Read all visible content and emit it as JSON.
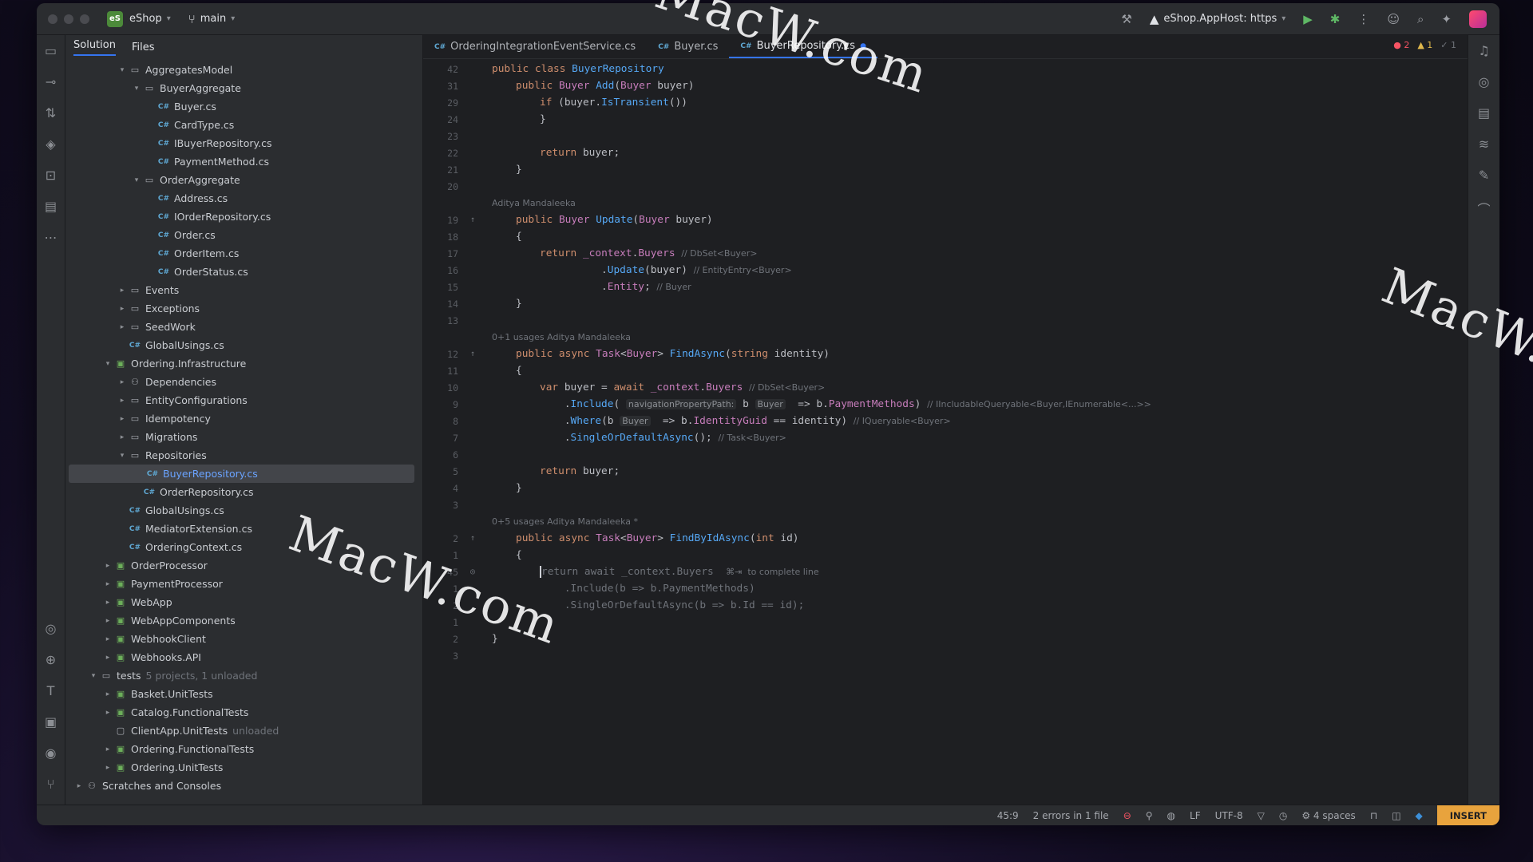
{
  "titlebar": {
    "project_badge": "eS",
    "project_name": "eShop",
    "branch": "main",
    "run_config": "eShop.AppHost: https"
  },
  "project_panel": {
    "tabs": [
      "Solution",
      "Files"
    ],
    "tree": [
      {
        "label": "AggregatesModel",
        "type": "folder",
        "indent": 3,
        "expanded": true
      },
      {
        "label": "BuyerAggregate",
        "type": "folder",
        "indent": 4,
        "expanded": true
      },
      {
        "label": "Buyer.cs",
        "type": "cs",
        "indent": 5
      },
      {
        "label": "CardType.cs",
        "type": "cs",
        "indent": 5
      },
      {
        "label": "IBuyerRepository.cs",
        "type": "cs",
        "indent": 5
      },
      {
        "label": "PaymentMethod.cs",
        "type": "cs",
        "indent": 5
      },
      {
        "label": "OrderAggregate",
        "type": "folder",
        "indent": 4,
        "expanded": true
      },
      {
        "label": "Address.cs",
        "type": "cs",
        "indent": 5
      },
      {
        "label": "IOrderRepository.cs",
        "type": "cs",
        "indent": 5
      },
      {
        "label": "Order.cs",
        "type": "cs",
        "indent": 5
      },
      {
        "label": "OrderItem.cs",
        "type": "cs",
        "indent": 5
      },
      {
        "label": "OrderStatus.cs",
        "type": "cs",
        "indent": 5
      },
      {
        "label": "Events",
        "type": "folder",
        "indent": 3,
        "expanded": false
      },
      {
        "label": "Exceptions",
        "type": "folder",
        "indent": 3,
        "expanded": false
      },
      {
        "label": "SeedWork",
        "type": "folder",
        "indent": 3,
        "expanded": false
      },
      {
        "label": "GlobalUsings.cs",
        "type": "cs",
        "indent": 3
      },
      {
        "label": "Ordering.Infrastructure",
        "type": "proj",
        "indent": 2,
        "expanded": true
      },
      {
        "label": "Dependencies",
        "type": "dep",
        "indent": 3,
        "expanded": false
      },
      {
        "label": "EntityConfigurations",
        "type": "folder",
        "indent": 3,
        "expanded": false
      },
      {
        "label": "Idempotency",
        "type": "folder",
        "indent": 3,
        "expanded": false
      },
      {
        "label": "Migrations",
        "type": "folder",
        "indent": 3,
        "expanded": false
      },
      {
        "label": "Repositories",
        "type": "folder",
        "indent": 3,
        "expanded": true
      },
      {
        "label": "BuyerRepository.cs",
        "type": "cs",
        "indent": 4,
        "selected": true
      },
      {
        "label": "OrderRepository.cs",
        "type": "cs",
        "indent": 4
      },
      {
        "label": "GlobalUsings.cs",
        "type": "cs",
        "indent": 3
      },
      {
        "label": "MediatorExtension.cs",
        "type": "cs",
        "indent": 3
      },
      {
        "label": "OrderingContext.cs",
        "type": "cs",
        "indent": 3
      },
      {
        "label": "OrderProcessor",
        "type": "proj",
        "indent": 2,
        "expanded": false
      },
      {
        "label": "PaymentProcessor",
        "type": "proj",
        "indent": 2,
        "expanded": false
      },
      {
        "label": "WebApp",
        "type": "proj",
        "indent": 2,
        "expanded": false
      },
      {
        "label": "WebAppComponents",
        "type": "proj",
        "indent": 2,
        "expanded": false
      },
      {
        "label": "WebhookClient",
        "type": "proj",
        "indent": 2,
        "expanded": false
      },
      {
        "label": "Webhooks.API",
        "type": "proj",
        "indent": 2,
        "expanded": false
      },
      {
        "label": "tests",
        "type": "folder",
        "indent": 1,
        "expanded": true,
        "note": "5 projects, 1 unloaded"
      },
      {
        "label": "Basket.UnitTests",
        "type": "proj",
        "indent": 2,
        "expanded": false
      },
      {
        "label": "Catalog.FunctionalTests",
        "type": "proj",
        "indent": 2,
        "expanded": false
      },
      {
        "label": "ClientApp.UnitTests",
        "type": "proj-unloaded",
        "indent": 2,
        "note": "unloaded"
      },
      {
        "label": "Ordering.FunctionalTests",
        "type": "proj",
        "indent": 2,
        "expanded": false
      },
      {
        "label": "Ordering.UnitTests",
        "type": "proj",
        "indent": 2,
        "expanded": false
      },
      {
        "label": "Scratches and Consoles",
        "type": "dep",
        "indent": 0,
        "expanded": false
      }
    ]
  },
  "editor": {
    "tabs": [
      {
        "label": "OrderingIntegrationEventService.cs",
        "active": false
      },
      {
        "label": "Buyer.cs",
        "active": false
      },
      {
        "label": "BuyerRepository.cs",
        "active": true,
        "modified": true
      }
    ],
    "inspections": {
      "errors": "2",
      "warnings": "1",
      "ok": "1"
    },
    "lines": [
      {
        "n": "42",
        "html": "<span class='kw'>public class </span><span class='ty2'>BuyerRepository</span>",
        "ind": 0
      },
      {
        "n": "31",
        "html": "<span class='kw'>public </span><span class='ty'>Buyer</span> <span class='fn'>Add</span>(<span class='ty'>Buyer</span> buyer)",
        "ind": 1
      },
      {
        "n": "29",
        "html": "<span class='kw'>if</span> (buyer.<span class='fn'>IsTransient</span>())",
        "ind": 2
      },
      {
        "n": "24",
        "html": "}",
        "ind": 2
      },
      {
        "n": "23",
        "html": "",
        "ind": 0
      },
      {
        "n": "22",
        "html": "<span class='kw'>return</span> buyer;",
        "ind": 2
      },
      {
        "n": "21",
        "html": "}",
        "ind": 1
      },
      {
        "n": "20",
        "html": "",
        "ind": 0
      },
      {
        "meta": "Aditya Mandaleeka"
      },
      {
        "n": "19",
        "mark": "↑",
        "html": "<span class='kw'>public </span><span class='ty'>Buyer</span> <span class='fn'>Update</span>(<span class='ty'>Buyer</span> buyer)",
        "ind": 1
      },
      {
        "n": "18",
        "html": "{",
        "ind": 1
      },
      {
        "n": "17",
        "html": "<span class='kw'>return</span> <span class='fld'>_context</span>.<span class='fld'>Buyers</span> <span class='hint'>// DbSet&lt;Buyer&gt;</span>",
        "ind": 2
      },
      {
        "n": "16",
        "html": "          .<span class='fn'>Update</span>(buyer) <span class='hint'>// EntityEntry&lt;Buyer&gt;</span>",
        "ind": 2
      },
      {
        "n": "15",
        "html": "          .<span class='fld'>Entity</span>; <span class='hint'>// Buyer</span>",
        "ind": 2
      },
      {
        "n": "14",
        "html": "}",
        "ind": 1
      },
      {
        "n": "13",
        "html": "",
        "ind": 0
      },
      {
        "meta": "0+1 usages   Aditya Mandaleeka"
      },
      {
        "n": "12",
        "mark": "↑",
        "html": "<span class='kw'>public async </span><span class='ty'>Task</span>&lt;<span class='ty'>Buyer</span>&gt; <span class='fn'>FindAsync</span>(<span class='kw'>string</span> identity)",
        "ind": 1
      },
      {
        "n": "11",
        "html": "{",
        "ind": 1
      },
      {
        "n": "10",
        "html": "<span class='kw'>var</span> buyer = <span class='kw'>await</span> <span class='fld'>_context</span>.<span class='fld'>Buyers</span> <span class='hint'>// DbSet&lt;Buyer&gt;</span>",
        "ind": 2
      },
      {
        "n": "9",
        "html": "    .<span class='fn'>Include</span>( <span class='inlay'>navigationPropertyPath:</span> b <span class='inlay'>Buyer</span>  =&gt; b.<span class='fld'>PaymentMethods</span>) <span class='hint'>// IIncludableQueryable&lt;Buyer,IEnumerable&lt;...&gt;&gt;</span>",
        "ind": 2
      },
      {
        "n": "8",
        "html": "    .<span class='fn'>Where</span>(b <span class='inlay'>Buyer</span>  =&gt; b.<span class='fld'>IdentityGuid</span> == identity) <span class='hint'>// IQueryable&lt;Buyer&gt;</span>",
        "ind": 2
      },
      {
        "n": "7",
        "html": "    .<span class='fn'>SingleOrDefaultAsync</span>(); <span class='hint'>// Task&lt;Buyer&gt;</span>",
        "ind": 2
      },
      {
        "n": "6",
        "html": "",
        "ind": 0
      },
      {
        "n": "5",
        "html": "<span class='kw'>return</span> buyer;",
        "ind": 2
      },
      {
        "n": "4",
        "html": "}",
        "ind": 1
      },
      {
        "n": "3",
        "html": "",
        "ind": 0
      },
      {
        "meta": "0+5 usages   Aditya Mandaleeka *"
      },
      {
        "n": "2",
        "mark": "↑",
        "html": "<span class='kw'>public async </span><span class='ty'>Task</span>&lt;<span class='ty'>Buyer</span>&gt; <span class='fn'>FindByIdAsync</span>(<span class='kw'>int</span> id)",
        "ind": 1
      },
      {
        "n": "1",
        "html": "{",
        "ind": 1
      },
      {
        "n": "45",
        "mark": "◎",
        "html": "<span class='caret'></span><span class='ghost'>return await _context.Buyers</span>  <span class='hint'>⌘⇥  to complete line</span>",
        "ind": 2
      },
      {
        "n": "1",
        "html": "<span class='ghost'>    .Include(b =&gt; b.PaymentMethods)</span>",
        "ind": 2
      },
      {
        "n": "2",
        "html": "<span class='ghost'>    .SingleOrDefaultAsync(b =&gt; b.Id == id);</span>",
        "ind": 2
      },
      {
        "n": "1",
        "html": "",
        "ind": 0
      },
      {
        "n": "2",
        "html": "}",
        "ind": 0
      },
      {
        "n": "3",
        "html": "",
        "ind": 0
      }
    ]
  },
  "statusbar": {
    "position": "45:9",
    "problems": "2 errors in 1 file",
    "line_ending": "LF",
    "encoding": "UTF-8",
    "indent": "4 spaces",
    "mode": "INSERT"
  },
  "watermark": "MacW.com",
  "colors": {
    "background": "#1e1f22",
    "panel": "#2b2d30",
    "accent": "#3574f0",
    "keyword": "#cf8e6d",
    "type": "#c77dbb",
    "method": "#56a8f5",
    "insert_badge": "#e8a33d"
  }
}
